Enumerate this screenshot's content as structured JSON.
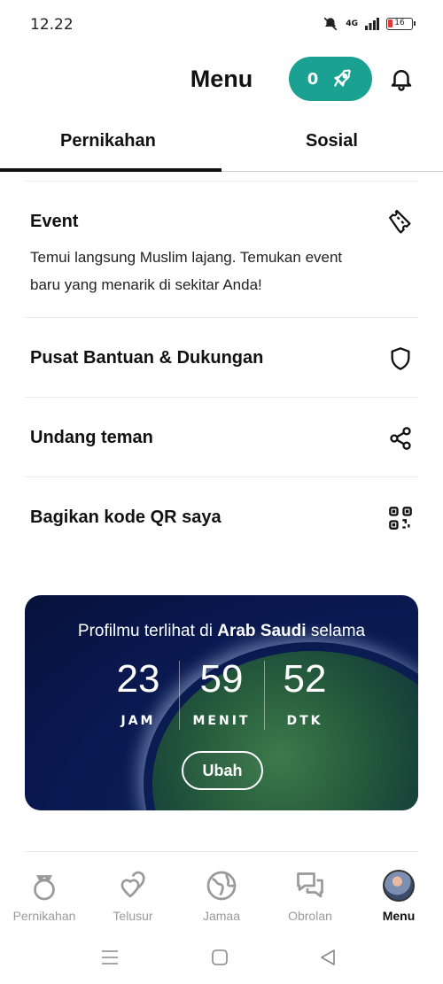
{
  "status_bar": {
    "time": "12.22",
    "network": "4G",
    "battery": "16"
  },
  "header": {
    "title": "Menu",
    "boost_count": "0"
  },
  "tabs": [
    {
      "label": "Pernikahan",
      "active": true
    },
    {
      "label": "Sosial",
      "active": false
    }
  ],
  "menu": {
    "event": {
      "title": "Event",
      "description": "Temui langsung Muslim lajang. Temukan event baru yang menarik di sekitar Anda!",
      "icon": "ticket-icon"
    },
    "support": {
      "title": "Pusat Bantuan & Dukungan",
      "icon": "shield-icon"
    },
    "invite": {
      "title": "Undang teman",
      "icon": "share-icon"
    },
    "qr": {
      "title": "Bagikan kode QR saya",
      "icon": "qr-code-icon"
    }
  },
  "promo": {
    "text_prefix": "Profilmu terlihat di ",
    "country": "Arab Saudi",
    "text_suffix": " selama",
    "hours": "23",
    "hours_label": "JAM",
    "minutes": "59",
    "minutes_label": "MENIT",
    "seconds": "52",
    "seconds_label": "DTK",
    "button": "Ubah"
  },
  "bottom_nav": [
    {
      "label": "Pernikahan",
      "icon": "ring-icon",
      "active": false
    },
    {
      "label": "Telusur",
      "icon": "hearts-icon",
      "active": false
    },
    {
      "label": "Jamaa",
      "icon": "globe-icon",
      "active": false
    },
    {
      "label": "Obrolan",
      "icon": "chat-icon",
      "active": false
    },
    {
      "label": "Menu",
      "icon": "avatar",
      "active": true
    }
  ],
  "colors": {
    "accent": "#1aa192",
    "promo_bg": "#0a1850"
  }
}
